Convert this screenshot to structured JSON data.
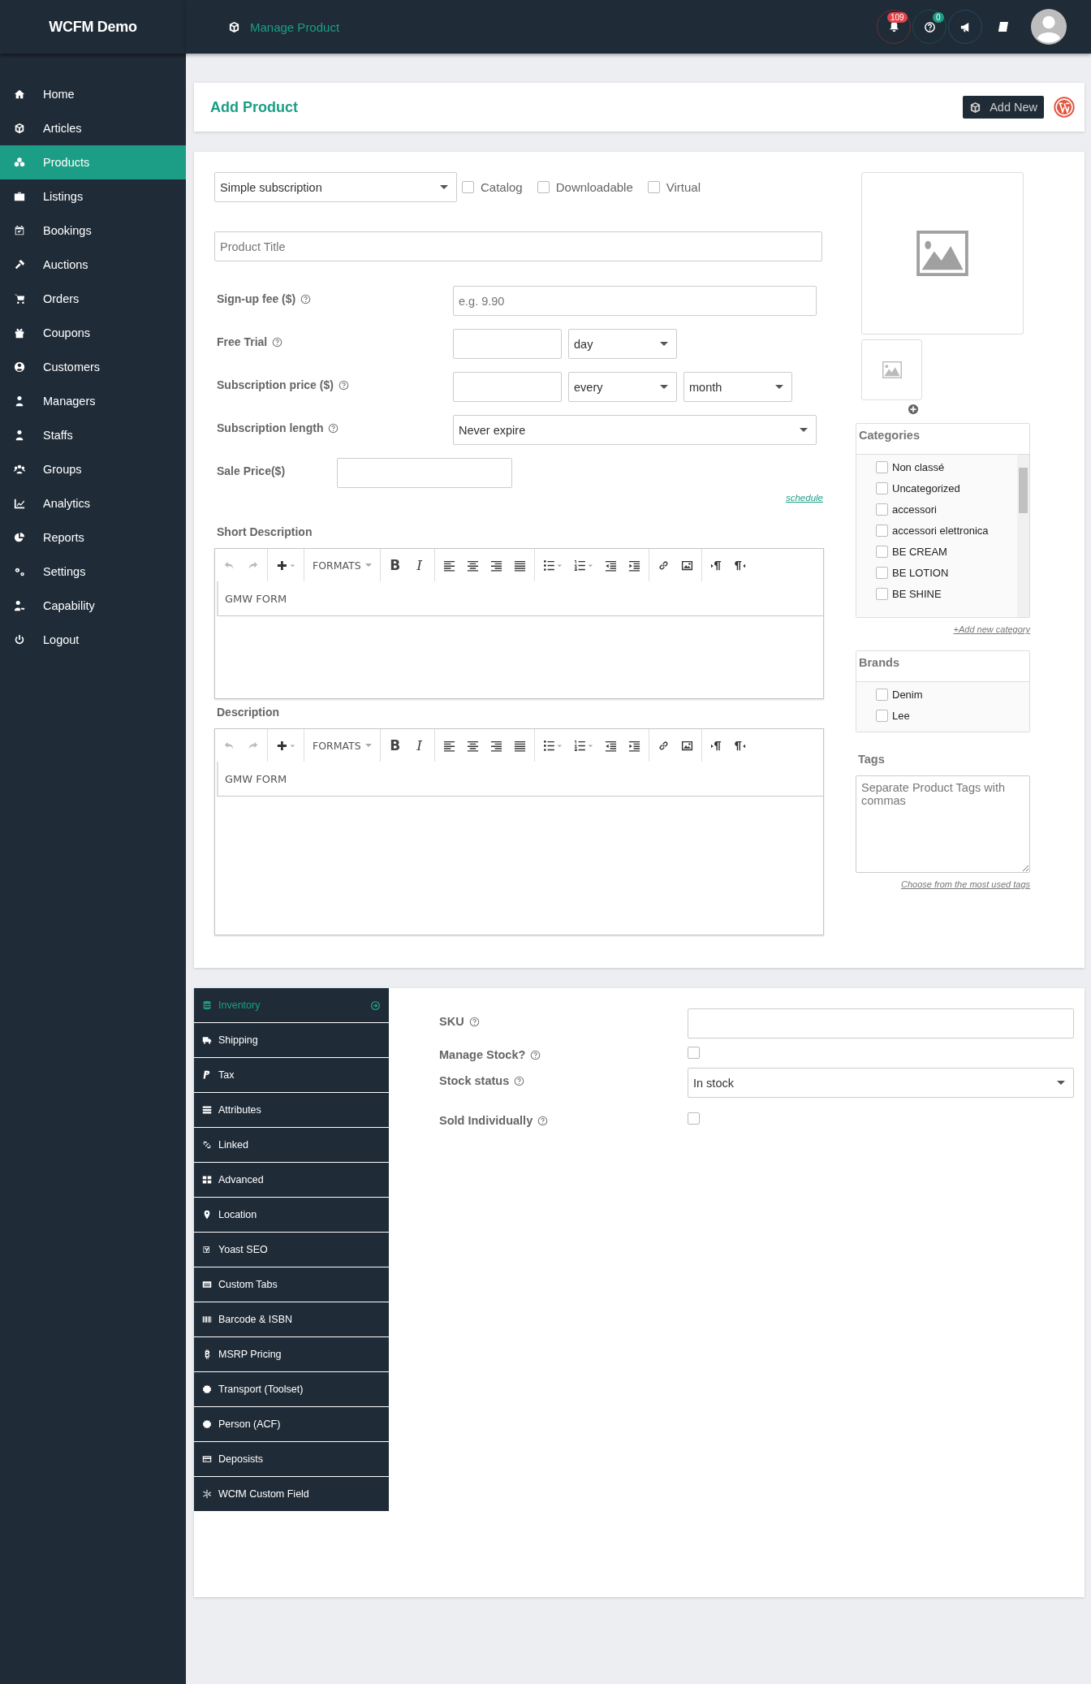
{
  "brand": "WCFM Demo",
  "topbar": {
    "title": "Manage Product",
    "notification_count": "109",
    "help_count": "0"
  },
  "sidebar": {
    "items": [
      {
        "label": "Home",
        "selected": false
      },
      {
        "label": "Articles",
        "selected": false
      },
      {
        "label": "Products",
        "selected": true
      },
      {
        "label": "Listings",
        "selected": false
      },
      {
        "label": "Bookings",
        "selected": false
      },
      {
        "label": "Auctions",
        "selected": false
      },
      {
        "label": "Orders",
        "selected": false
      },
      {
        "label": "Coupons",
        "selected": false
      },
      {
        "label": "Customers",
        "selected": false
      },
      {
        "label": "Managers",
        "selected": false
      },
      {
        "label": "Staffs",
        "selected": false
      },
      {
        "label": "Groups",
        "selected": false
      },
      {
        "label": "Analytics",
        "selected": false
      },
      {
        "label": "Reports",
        "selected": false
      },
      {
        "label": "Settings",
        "selected": false
      },
      {
        "label": "Capability",
        "selected": false
      },
      {
        "label": "Logout",
        "selected": false
      }
    ]
  },
  "header": {
    "title": "Add Product",
    "add_new": "Add New"
  },
  "product_type": {
    "value": "Simple subscription"
  },
  "options": [
    {
      "label": "Catalog",
      "checked": false
    },
    {
      "label": "Downloadable",
      "checked": false
    },
    {
      "label": "Virtual",
      "checked": false
    }
  ],
  "title_field": {
    "placeholder": "Product Title"
  },
  "fields": [
    {
      "kind": "text",
      "label": "Sign-up fee ($)",
      "help": true,
      "placeholder": "e.g. 9.90"
    },
    {
      "kind": "trial",
      "label": "Free Trial",
      "help": true,
      "selects": [
        "day"
      ]
    },
    {
      "kind": "price",
      "label": "Subscription price ($)",
      "help": true,
      "selects": [
        "every",
        "month"
      ]
    },
    {
      "kind": "select",
      "label": "Subscription length",
      "help": true,
      "value": "Never expire"
    },
    {
      "kind": "sale",
      "label": "Sale Price($)",
      "help": false
    }
  ],
  "schedule_link": "schedule",
  "editors": [
    {
      "label": "Short Description",
      "formats": "FORMATS",
      "bold": "B",
      "italic": "I",
      "form_button": "GMW FORM"
    },
    {
      "label": "Description",
      "formats": "FORMATS",
      "bold": "B",
      "italic": "I",
      "form_button": "GMW FORM"
    }
  ],
  "categories": {
    "title": "Categories",
    "items": [
      {
        "label": "Non classé",
        "checked": false
      },
      {
        "label": "Uncategorized",
        "checked": false
      },
      {
        "label": "accessori",
        "checked": false
      },
      {
        "label": "accessori elettronica",
        "checked": false
      },
      {
        "label": "BE CREAM",
        "checked": false
      },
      {
        "label": "BE LOTION",
        "checked": false
      },
      {
        "label": "BE SHINE",
        "checked": false
      }
    ],
    "add_link": "+Add new category"
  },
  "brands": {
    "title": "Brands",
    "items": [
      {
        "label": "Denim",
        "checked": false
      },
      {
        "label": "Lee",
        "checked": false
      }
    ]
  },
  "tags": {
    "title": "Tags",
    "placeholder": "Separate Product Tags with commas",
    "link": "Choose from the most used tags"
  },
  "tabs": [
    {
      "label": "Inventory",
      "selected": true
    },
    {
      "label": "Shipping",
      "selected": false
    },
    {
      "label": "Tax",
      "selected": false
    },
    {
      "label": "Attributes",
      "selected": false
    },
    {
      "label": "Linked",
      "selected": false
    },
    {
      "label": "Advanced",
      "selected": false
    },
    {
      "label": "Location",
      "selected": false
    },
    {
      "label": "Yoast SEO",
      "selected": false
    },
    {
      "label": "Custom Tabs",
      "selected": false
    },
    {
      "label": "Barcode & ISBN",
      "selected": false
    },
    {
      "label": "MSRP Pricing",
      "selected": false
    },
    {
      "label": "Transport (Toolset)",
      "selected": false
    },
    {
      "label": "Person (ACF)",
      "selected": false
    },
    {
      "label": "Deposists",
      "selected": false
    },
    {
      "label": "WCfM Custom Field",
      "selected": false
    }
  ],
  "inventory": {
    "fields": [
      {
        "kind": "text",
        "label": "SKU"
      },
      {
        "kind": "checkbox",
        "label": "Manage Stock?",
        "checked": false
      },
      {
        "kind": "select",
        "label": "Stock status",
        "value": "In stock"
      },
      {
        "kind": "checkbox",
        "label": "Sold Individually",
        "checked": false
      }
    ]
  }
}
